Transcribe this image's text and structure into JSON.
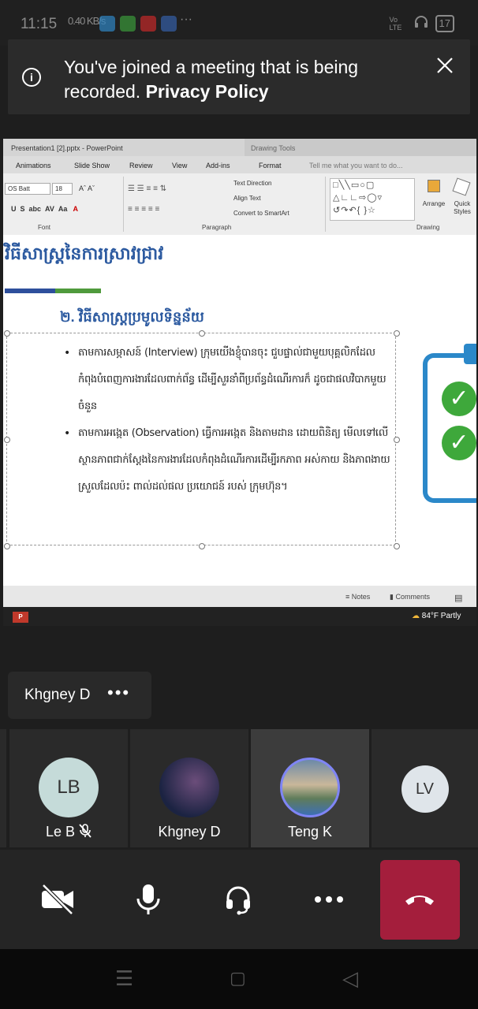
{
  "status_bar": {
    "time": "11:15",
    "signal_text": "0.40 KB/s",
    "more": "···",
    "network": "Vo LTE",
    "battery": "17"
  },
  "banner": {
    "message": "You've joined a meeting that is being recorded.",
    "link": "Privacy Policy"
  },
  "ppt": {
    "title": "Presentation1 [2].pptx - PowerPoint",
    "drawing_tools": "Drawing Tools",
    "tabs": [
      "Animations",
      "Slide Show",
      "Review",
      "View",
      "Add-ins",
      "Format"
    ],
    "tell_me": "Tell me what you want to do...",
    "font_name": "OS Batt",
    "font_size": "18",
    "text_direction": "Text Direction",
    "align_text": "Align Text",
    "convert_smartart": "Convert to SmartArt",
    "arrange": "Arrange",
    "quick_styles": "Quick Styles",
    "groups": [
      "Font",
      "Paragraph",
      "Drawing"
    ],
    "slide_title": "វិធីសាស្ត្រនៃការស្រាវជ្រាវ",
    "slide_subtitle": "២. វិធីសាស្ត្រប្រមូលទិន្នន័យ",
    "bullets": [
      "តាមការសម្ភាសន៍ (Interview) ក្រុមយើងខ្ញុំបានចុះ ជួបផ្ទាល់ជាមួយបុគ្គលិកដែលកំពុងបំពេញការងារដែលពាក់ព័ន្ធ ដើម្បីសួរនាំពីប្រព័ន្ធដំណើរការក៏ ដូចជាផលវិបាកមួយចំនួន",
      "តាមការអង្កេត (Observation) ធ្វើការអង្កេត និងតាមដាន ដោយពិនិត្យ មើលទៅលើស្ថានភាពជាក់ស្តែងនៃការងារដែលកំពុងដំណើរការដើម្បីរកភាព អស់កាយ និងភាពងាយស្រួលដែលប៉ះ ពាល់ដល់ផល ប្រយោជន៍ របស់ ក្រុមហ៊ុន។"
    ],
    "notes": "Notes",
    "comments": "Comments",
    "weather": "84°F Partly"
  },
  "participant_pill": {
    "name": "Khgney D",
    "more": "•••"
  },
  "participants": [
    {
      "initials": "LB",
      "name": "Le B"
    },
    {
      "initials": "",
      "name": "Khgney D"
    },
    {
      "initials": "",
      "name": "Teng K"
    },
    {
      "initials": "LV",
      "name": ""
    }
  ],
  "colors": {
    "leave": "#a41e3c",
    "accent": "#2c5aa0",
    "check": "#3ea83b"
  }
}
